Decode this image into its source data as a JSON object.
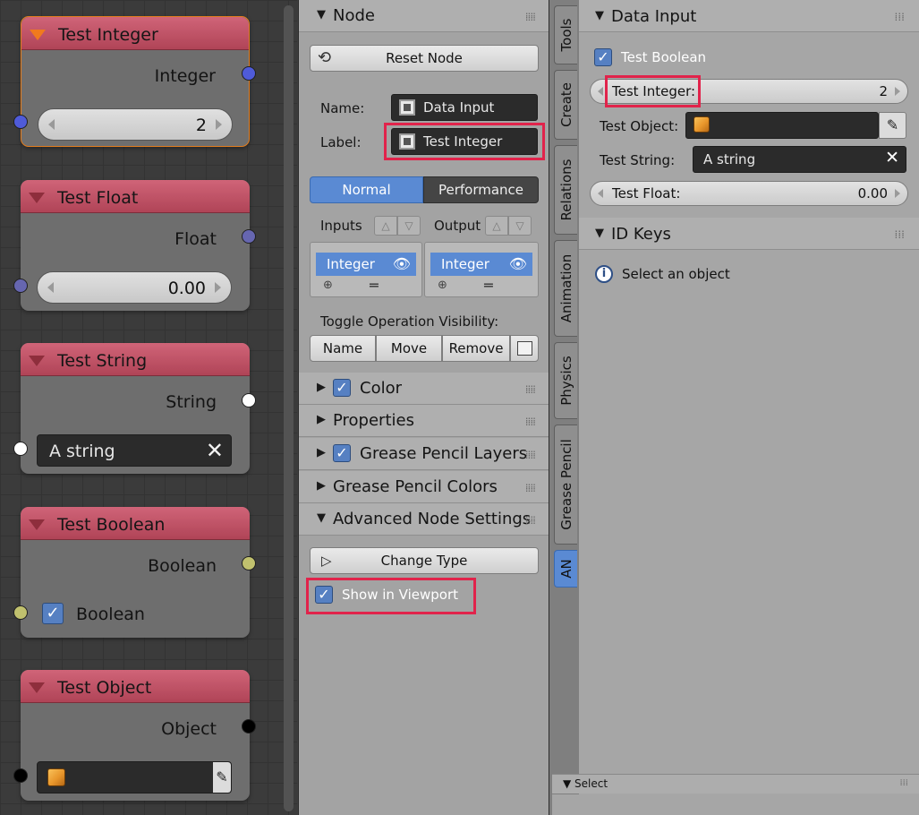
{
  "nodes": [
    {
      "title": "Test Integer",
      "output": "Integer",
      "value": "2"
    },
    {
      "title": "Test Float",
      "output": "Float",
      "value": "0.00"
    },
    {
      "title": "Test String",
      "output": "String",
      "value": "A string"
    },
    {
      "title": "Test Boolean",
      "output": "Boolean",
      "value": "Boolean"
    },
    {
      "title": "Test Object",
      "output": "Object"
    }
  ],
  "colors": {
    "integer_socket": "#4f5bd9",
    "float_socket": "#6666b0",
    "string_socket": "#ffffff",
    "boolean_socket": "#c1c16e",
    "object_socket": "#000000",
    "node_header": "#c2566a",
    "accent": "#5a8ad3",
    "highlight_box": "#e1234b"
  },
  "mid": {
    "node_header": "Node",
    "reset_node": "Reset Node",
    "name_label": "Name:",
    "name_value": "Data Input",
    "label_label": "Label:",
    "label_value": "Test Integer",
    "mode_normal": "Normal",
    "mode_performance": "Performance",
    "inputs_label": "Inputs",
    "output_label": "Output",
    "inputs_item": "Integer",
    "output_item": "Integer",
    "toggle_label": "Toggle Operation Visibility:",
    "toggle_name": "Name",
    "toggle_move": "Move",
    "toggle_remove": "Remove",
    "sections": [
      "Color",
      "Properties",
      "Grease Pencil Layers",
      "Grease Pencil Colors",
      "Advanced Node Settings"
    ],
    "change_type": "Change Type",
    "show_in_viewport": "Show in Viewport"
  },
  "tabs": [
    "Tools",
    "Create",
    "Relations",
    "Animation",
    "Physics",
    "Grease Pencil",
    "AN"
  ],
  "right": {
    "data_input_header": "Data Input",
    "test_boolean": "Test Boolean",
    "test_integer_label": "Test Integer:",
    "test_integer_value": "2",
    "test_object_label": "Test Object:",
    "test_string_label": "Test String:",
    "test_string_value": "A string",
    "test_float_label": "Test Float:",
    "test_float_value": "0.00",
    "id_keys_header": "ID Keys",
    "select_object_msg": "Select an object",
    "bottom_select": "Select"
  },
  "icons": [
    "collapse-triangle-icon",
    "checkbox-checked-icon",
    "clear-x-icon",
    "cube-object-icon",
    "eyedropper-icon",
    "reset-icon",
    "node-icon",
    "eye-icon",
    "add-plus-icon",
    "drag-handle-icon",
    "info-icon",
    "arrow-up-icon",
    "arrow-down-icon"
  ]
}
